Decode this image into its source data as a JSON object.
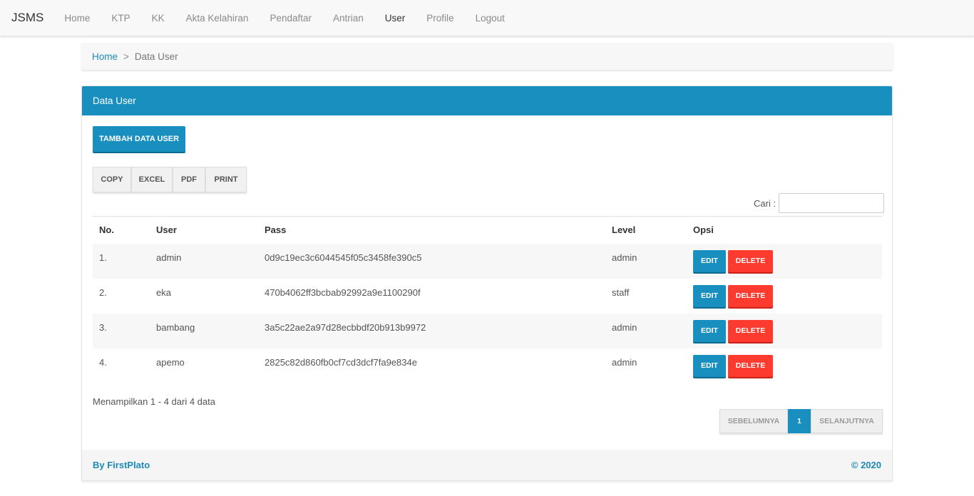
{
  "nav": {
    "brand": "JSMS",
    "items": [
      "Home",
      "KTP",
      "KK",
      "Akta Kelahiran",
      "Pendaftar",
      "Antrian",
      "User",
      "Profile",
      "Logout"
    ],
    "active": "User"
  },
  "breadcrumb": {
    "home": "Home",
    "separator": ">",
    "current": "Data User"
  },
  "panel": {
    "title": "Data User",
    "add_button": "TAMBAH DATA USER",
    "exports": [
      "COPY",
      "EXCEL",
      "PDF",
      "PRINT"
    ],
    "search_label": "Cari :",
    "search_value": ""
  },
  "table": {
    "headers": [
      "No.",
      "User",
      "Pass",
      "Level",
      "Opsi"
    ],
    "edit_label": "EDIT",
    "delete_label": "DELETE",
    "rows": [
      {
        "no": "1.",
        "user": "admin",
        "pass": "0d9c19ec3c6044545f05c3458fe390c5",
        "level": "admin"
      },
      {
        "no": "2.",
        "user": "eka",
        "pass": "470b4062ff3bcbab92992a9e1100290f",
        "level": "staff"
      },
      {
        "no": "3.",
        "user": "bambang",
        "pass": "3a5c22ae2a97d28ecbbdf20b913b9972",
        "level": "admin"
      },
      {
        "no": "4.",
        "user": "apemo",
        "pass": "2825c82d860fb0cf7cd3dcf7fa9e834e",
        "level": "admin"
      }
    ]
  },
  "info": "Menampilkan 1 - 4 dari 4 data",
  "pagination": {
    "prev": "SEBELUMNYA",
    "page": "1",
    "next": "SELANJUTNYA"
  },
  "footer": {
    "left": "By FirstPlato",
    "right": "© 2020"
  },
  "colors": {
    "primary": "#188fbf",
    "danger": "#ff3b30",
    "link": "#1a8ab8"
  }
}
